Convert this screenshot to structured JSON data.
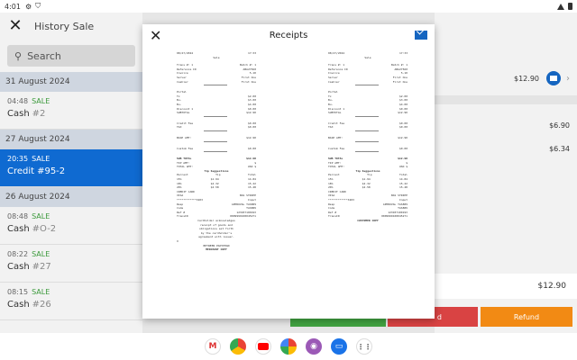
{
  "status_bar": {
    "time": "4:01",
    "icons": [
      "gear-icon",
      "shield-icon"
    ]
  },
  "left_pane": {
    "title": "History Sale",
    "search_placeholder": "Search",
    "groups": [
      {
        "date": "31 August 2024",
        "items": [
          {
            "time": "04:48",
            "kind": "SALE",
            "method": "Cash",
            "number": "#2"
          }
        ]
      },
      {
        "date": "27 August 2024",
        "items": [
          {
            "time": "20:35",
            "kind": "SALE",
            "method": "Credit",
            "number": "#95-2",
            "selected": true
          }
        ]
      },
      {
        "date": "26 August 2024",
        "items": [
          {
            "time": "08:48",
            "kind": "SALE",
            "method": "Cash",
            "number": "#O-2"
          },
          {
            "time": "08:22",
            "kind": "SALE",
            "method": "Cash",
            "number": "#27"
          },
          {
            "time": "08:15",
            "kind": "SALE",
            "method": "Cash",
            "number": "#26"
          }
        ]
      }
    ]
  },
  "right_pane": {
    "header_amount": "$12.90",
    "rows": [
      "$6.90",
      "$6.34"
    ],
    "total": "$12.90",
    "refund_label": "Refund",
    "red_label": "d"
  },
  "modal": {
    "title": "Receipts",
    "colors": {
      "accent": "#1565c0"
    },
    "receipt_left": {
      "header": [
        "08/27/2024",
        "17:33"
      ],
      "subtitle": "Sale",
      "lines": [
        [
          "Trans #: 1",
          "Batch #: 1"
        ],
        [
          "Reference ID",
          "ABA27560"
        ],
        [
          "Invoice",
          "5-10"
        ],
        [
          "Server",
          "First One"
        ],
        [
          "Cashier",
          "First One"
        ]
      ],
      "label_pos": "Portal",
      "items": [
        [
          "Tx",
          "$2.00"
        ],
        [
          "Bu-",
          "$3.00"
        ],
        [
          "Bu-",
          "$4.00"
        ],
        [
          "Discount 1",
          "$0.00"
        ],
        [
          "SUBTOTAL",
          "$12.90"
        ]
      ],
      "credit_fee": [
        "Credit Fee",
        "$0.00"
      ],
      "tax": [
        "TAX",
        "$0.00"
      ],
      "base_amt": [
        "BASE AMT:",
        "$12.90"
      ],
      "custom_fee": [
        "Custom Fee",
        "$0.00"
      ],
      "sub_total": [
        "SUB TOTAL",
        "$12.90"
      ],
      "tip_amt": [
        "TIP AMT:",
        "$"
      ],
      "total_amt": [
        "TOTAL AMT:",
        "USD $"
      ],
      "tip_title": "Tip Suggestions",
      "tip_head": [
        "Percent",
        "Tip",
        "Total"
      ],
      "tip_rows": [
        [
          "15%",
          "$1.94",
          "14.84"
        ],
        [
          "18%",
          "$2.32",
          "15.22"
        ],
        [
          "20%",
          "$2.58",
          "15.48"
        ]
      ],
      "card_label": "CREDIT CARD",
      "card_rows": [
        [
          "VISA",
          "BAS STRIPE"
        ],
        [
          "************3203",
          "Input"
        ],
        [
          "Resp",
          "APPROVAL TAS889"
        ],
        [
          "Code",
          "TAS889"
        ],
        [
          "Ref #",
          "123937100193"
        ],
        [
          "TransID",
          "0009999100045271"
        ]
      ],
      "footer": [
        "Cardholder acknowledges",
        "receipt of goods and",
        "obligations set forth",
        "by the cardholder's",
        "agreement with issuer."
      ],
      "sign_label": "X",
      "sign_sub": "BETWEEN PADYPHAN",
      "copy_label": "MERCHANT COPY"
    },
    "receipt_right": {
      "header": [
        "08/27/2024",
        "17:33"
      ],
      "subtitle": "Sale",
      "lines": [
        [
          "Trans #: 1",
          "Batch #: 1"
        ],
        [
          "Reference ID",
          "ABA27560"
        ],
        [
          "Invoice",
          "5-10"
        ],
        [
          "Server",
          "First One"
        ],
        [
          "Cashier",
          "First One"
        ]
      ],
      "label_pos": "Portal",
      "items": [
        [
          "Tx",
          "$2.00"
        ],
        [
          "Bu-",
          "$3.00"
        ],
        [
          "Bu-",
          "$4.00"
        ],
        [
          "Discount 1",
          "$0.00"
        ],
        [
          "SUBTOTAL",
          "$12.90"
        ]
      ],
      "credit_fee": [
        "Credit Fee",
        "$0.00"
      ],
      "tax": [
        "TAX",
        "$0.00"
      ],
      "base_amt": [
        "BASE AMT:",
        "$12.90"
      ],
      "custom_fee": [
        "Custom Fee",
        "$0.00"
      ],
      "sub_total": [
        "SUB TOTAL",
        "$12.90"
      ],
      "tip_amt": [
        "TIP AMT:",
        "$"
      ],
      "total_amt": [
        "TOTAL AMT:",
        "USD $"
      ],
      "tip_title": "Tip Suggestions",
      "tip_head": [
        "Percent",
        "Tip",
        "Total"
      ],
      "tip_rows": [
        [
          "15%",
          "$1.94",
          "14.84"
        ],
        [
          "18%",
          "$2.32",
          "15.22"
        ],
        [
          "20%",
          "$2.58",
          "15.48"
        ]
      ],
      "card_label": "CREDIT CARD",
      "card_rows": [
        [
          "VISA",
          "BAS STRIPE"
        ],
        [
          "************3203",
          "Input"
        ],
        [
          "Resp",
          "APPROVAL TAS889"
        ],
        [
          "Code",
          "TAS889"
        ],
        [
          "Ref #",
          "123937100193"
        ],
        [
          "TransID",
          "0009999100045271"
        ]
      ],
      "copy_label": "CUSTOMER COPY"
    }
  },
  "taskbar": {
    "apps": [
      "gmail-icon",
      "chrome-icon",
      "youtube-icon",
      "photos-icon",
      "podcasts-icon",
      "files-icon",
      "app-grid-icon"
    ]
  }
}
